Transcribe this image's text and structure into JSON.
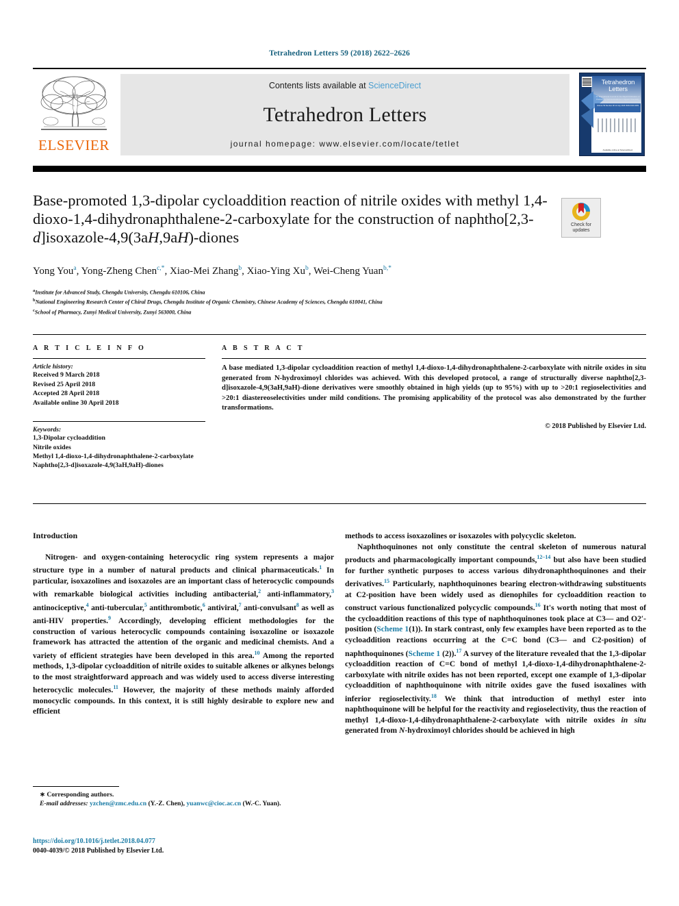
{
  "citation": "Tetrahedron Letters 59 (2018) 2622–2626",
  "masthead": {
    "publisher_logo_text": "ELSEVIER",
    "contents_prefix": "Contents lists available at ",
    "contents_link": "ScienceDirect",
    "journal_name": "Tetrahedron Letters",
    "homepage": "journal homepage: www.elsevier.com/locate/tetlet",
    "cover": {
      "title_line1": "Tetrahedron",
      "title_line2": "Letters",
      "subtitle": "An International Journal for the Rapid Publication of Preliminary Communications in Organic Chemistry",
      "band_text": "Volume 59  Number 28  12 July 2018  ISSN 0040-4039",
      "footer": "Available online at ScienceDirect"
    }
  },
  "article": {
    "title": "Base-promoted 1,3-dipolar cycloaddition reaction of nitrile oxides with methyl 1,4-dioxo-1,4-dihydronaphthalene-2-carboxylate for the construction of naphtho[2,3-d]isoxazole-4,9(3aH,9aH)-diones",
    "crossmark_label_line1": "Check for",
    "crossmark_label_line2": "updates",
    "authors": [
      {
        "name": "Yong You",
        "sup": "a"
      },
      {
        "name": "Yong-Zheng Chen",
        "sup": "c,*"
      },
      {
        "name": "Xiao-Mei Zhang",
        "sup": "b"
      },
      {
        "name": "Xiao-Ying Xu",
        "sup": "b"
      },
      {
        "name": "Wei-Cheng Yuan",
        "sup": "b,*"
      }
    ],
    "affiliations": [
      {
        "label": "a",
        "text": "Institute for Advanced Study, Chengdu University, Chengdu 610106, China"
      },
      {
        "label": "b",
        "text": "National Engineering Research Center of Chiral Drugs, Chengdu Institute of Organic Chemistry, Chinese Academy of Sciences, Chengdu 610041, China"
      },
      {
        "label": "c",
        "text": "School of Pharmacy, Zunyi Medical University, Zunyi 563000, China"
      }
    ]
  },
  "article_info": {
    "heading": "A R T I C L E   I N F O",
    "history_label": "Article history:",
    "history": [
      "Received 9 March 2018",
      "Revised 25 April 2018",
      "Accepted 28 April 2018",
      "Available online 30 April 2018"
    ],
    "keywords_label": "Keywords:",
    "keywords": [
      "1,3-Dipolar cycloaddition",
      "Nitrile oxides",
      "Methyl 1,4-dioxo-1,4-dihydronaphthalene-2-carboxylate",
      "Naphtho[2,3-d]isoxazole-4,9(3aH,9aH)-diones"
    ]
  },
  "abstract": {
    "heading": "A B S T R A C T",
    "text": "A base mediated 1,3-dipolar cycloaddition reaction of methyl 1,4-dioxo-1,4-dihydronaphthalene-2-carboxylate with nitrile oxides in situ generated from N-hydroximoyl chlorides was achieved. With this developed protocol, a range of structurally diverse naphtho[2,3-d]isoxazole-4,9(3aH,9aH)-dione derivatives were smoothly obtained in high yields (up to 95%) with up to >20:1 regioselectivities and >20:1 diastereoselectivities under mild conditions. The promising applicability of the protocol was also demonstrated by the further transformations.",
    "copyright": "© 2018 Published by Elsevier Ltd."
  },
  "body": {
    "intro_heading": "Introduction",
    "left_p1": "Nitrogen- and oxygen-containing heterocyclic ring system represents a major structure type in a number of natural products and clinical pharmaceuticals.1 In particular, isoxazolines and isoxazoles are an important class of heterocyclic compounds with remarkable biological activities including antibacterial,2 anti-inflammatory,3 antinociceptive,4 anti-tubercular,5 antithrombotic,6 antiviral,7 anticonvulsant8 as well as anti-HIV properties.9 Accordingly, developing efficient methodologies for the construction of various heterocyclic compounds containing isoxazoline or isoxazole framework has attracted the attention of the organic and medicinal chemists. And a variety of efficient strategies have been developed in this area.10 Among the reported methods, 1,3-dipolar cycloaddition of nitrile oxides to suitable alkenes or alkynes belongs to the most straightforward approach and was widely used to access diverse interesting heterocyclic molecules.11 However, the majority of these methods mainly afforded monocyclic compounds. In this context, it is still highly desirable to explore new and efficient methods to access isoxazolines or isoxazoles with polycyclic skeleton.",
    "right_p2": "Naphthoquinones not only constitute the central skeleton of numerous natural products and pharmacologically important compounds,12–14 but also have been studied for further synthetic purposes to access various dihydronaphthoquinones and their derivatives.15 Particularly, naphthoquinones bearing electron-withdrawing substituents at C2-position have been widely used as dienophiles for cycloaddition reaction to construct various functionalized polycyclic compounds.16 It's worth noting that most of the cycloaddition reactions of this type of naphthoquinones took place at C3— and O2′-position (Scheme 1(1)). In stark contrast, only few examples have been reported as to the cycloaddition reactions occurring at the C=C bond (C3— and C2-position) of naphthoquinones (Scheme 1 (2)).17 A survey of the literature revealed that the 1,3-dipolar cycloaddition reaction of C=C bond of methyl 1,4-dioxo-1,4-dihydronaphthalene-2-carboxylate with nitrile oxides has not been reported, except one example of 1,3-dipolar cycloaddition of naphthoquinone with nitrile oxides gave the fused isoxalines with inferior regioselectivity.18 We think that introduction of methyl ester into naphthoquinone will be helpful for the reactivity and regioselectivity, thus the reaction of methyl 1,4-dioxo-1,4-dihydronaphthalene-2-carboxylate with nitrile oxides in situ generated from N-hydroximoyl chlorides should be achieved in high"
  },
  "footnote": {
    "corresponding": "∗ Corresponding authors.",
    "email_label": "E-mail addresses:",
    "email1": "yzchen@zmc.edu.cn",
    "email1_owner": "(Y.-Z. Chen),",
    "email2": "yuanwc@cioc.ac.cn",
    "email2_owner": "(W.-C. Yuan)."
  },
  "doi": {
    "link": "https://doi.org/10.1016/j.tetlet.2018.04.077",
    "issn_line": "0040-4039/© 2018 Published by Elsevier Ltd."
  },
  "colors": {
    "link_blue": "#1a7ba5",
    "sciencedirect_blue": "#4a9ed0",
    "elsevier_orange": "#eb6608",
    "band_gray": "#e6e6e6"
  }
}
